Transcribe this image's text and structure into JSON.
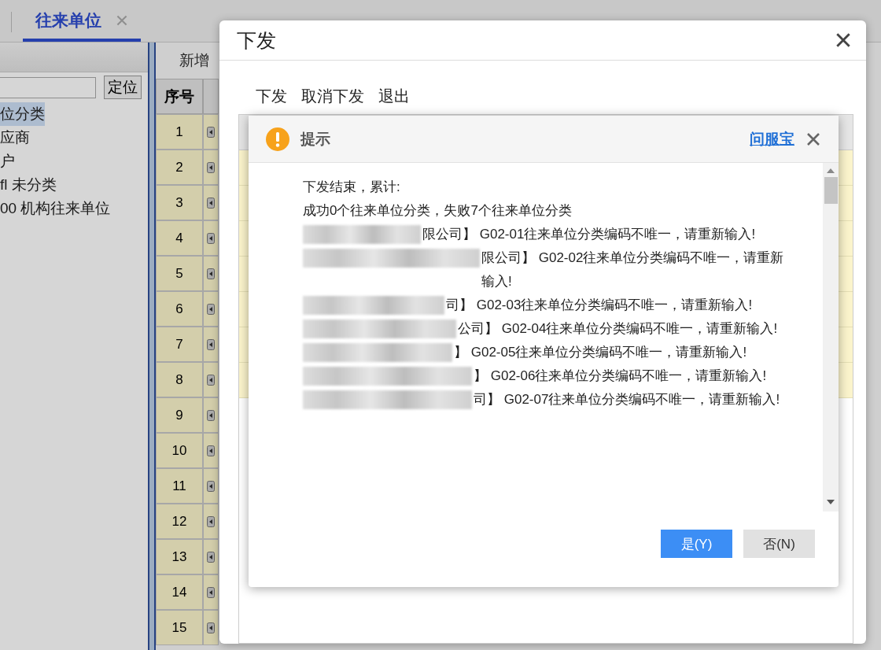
{
  "tab": {
    "label": "往来单位",
    "selected": true
  },
  "left_panel": {
    "locate_button": "定位",
    "tree": [
      {
        "label": "位分类",
        "selected": true
      },
      {
        "label": "应商",
        "selected": false
      },
      {
        "label": "户",
        "selected": false
      },
      {
        "label": "fl 未分类",
        "selected": false
      },
      {
        "label": "00 机构往来单位",
        "selected": false
      }
    ]
  },
  "toolbar": [
    "新增"
  ],
  "table": {
    "columns": [
      "序号"
    ],
    "rows": [
      "1",
      "2",
      "3",
      "4",
      "5",
      "6",
      "7",
      "8",
      "9",
      "10",
      "11",
      "12",
      "13",
      "14",
      "15"
    ]
  },
  "dialog": {
    "title": "下发",
    "toolbar": [
      "下发",
      "取消下发",
      "退出"
    ]
  },
  "prompt": {
    "title": "提示",
    "help_link": "问服宝",
    "lines": [
      {
        "kind": "text",
        "text": "下发结束，累计:"
      },
      {
        "kind": "text",
        "text": "成功0个往来单位分类，失败7个往来单位分类"
      },
      {
        "kind": "redacted",
        "text": "限公司】 G02-01往来单位分类编码不唯一，请重新输入!"
      },
      {
        "kind": "redacted",
        "text": "限公司】 G02-02往来单位分类编码不唯一，请重新输入!"
      },
      {
        "kind": "redacted",
        "text": "司】 G02-03往来单位分类编码不唯一，请重新输入!"
      },
      {
        "kind": "redacted",
        "text": "公司】 G02-04往来单位分类编码不唯一，请重新输入!"
      },
      {
        "kind": "redacted",
        "text": "】 G02-05往来单位分类编码不唯一，请重新输入!"
      },
      {
        "kind": "redacted",
        "text": "】 G02-06往来单位分类编码不唯一，请重新输入!"
      },
      {
        "kind": "redacted",
        "text": "司】 G02-07往来单位分类编码不唯一，请重新输入!"
      }
    ],
    "buttons": [
      {
        "label": "是(Y)",
        "primary": true
      },
      {
        "label": "否(N)",
        "primary": false
      }
    ]
  }
}
